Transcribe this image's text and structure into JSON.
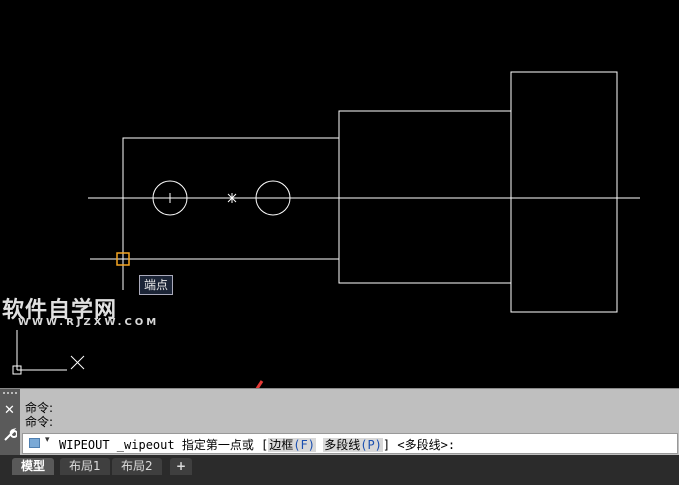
{
  "drawing": {
    "tooltip": "端点",
    "watermark": "软件自学网",
    "watermark_sub": "WWW.RJZXW.COM",
    "colors": {
      "background": "#000000",
      "lines": "#ffffff",
      "snap_marker": "#f5a623",
      "arrow": "#e53935"
    }
  },
  "command": {
    "history": [
      "命令:",
      "命令:"
    ],
    "prompt_cmd": "WIPEOUT _wipeout 指定第一点或 [",
    "option1_label": "边框",
    "option1_key": "(F)",
    "option2_label": "多段线",
    "option2_key": "(P)",
    "prompt_tail": "] <多段线>:",
    "close_icon": "close-icon",
    "customize_icon": "wrench-icon"
  },
  "layout_tabs": [
    {
      "label": "模型",
      "active": true
    },
    {
      "label": "布局1",
      "active": false
    },
    {
      "label": "布局2",
      "active": false
    },
    {
      "label": "+",
      "active": false
    }
  ]
}
